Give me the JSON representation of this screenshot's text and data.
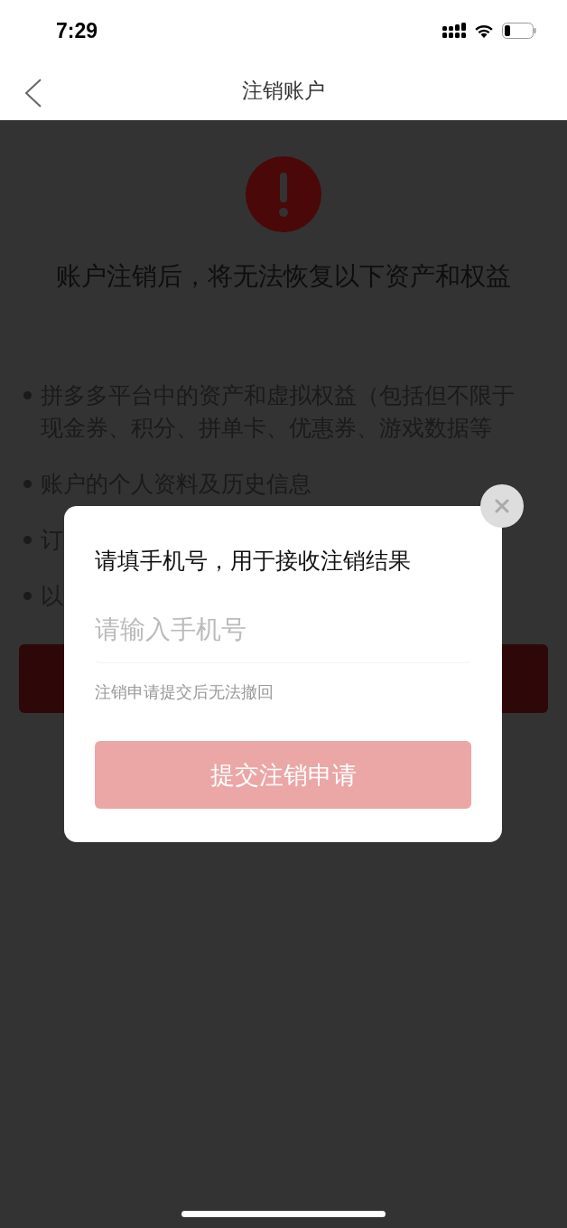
{
  "status_bar": {
    "time": "7:29"
  },
  "nav": {
    "title": "注销账户"
  },
  "page": {
    "heading": "账户注销后，将无法恢复以下资产和权益",
    "items": [
      {
        "text": "拼多多平台中的资产和虚拟权益（包括但不限于现金券、积分、拼单卡、优惠券、游戏数据等"
      },
      {
        "text": "账户的个人资料及历史信息"
      },
      {
        "text": "订"
      },
      {
        "text": "以"
      }
    ]
  },
  "dialog": {
    "title": "请填手机号，用于接收注销结果",
    "phone_field": {
      "placeholder": "请输入手机号"
    },
    "hint": "注销申请提交后无法撤回",
    "submit": {
      "label": "提交注销申请",
      "disabled": true
    }
  }
}
